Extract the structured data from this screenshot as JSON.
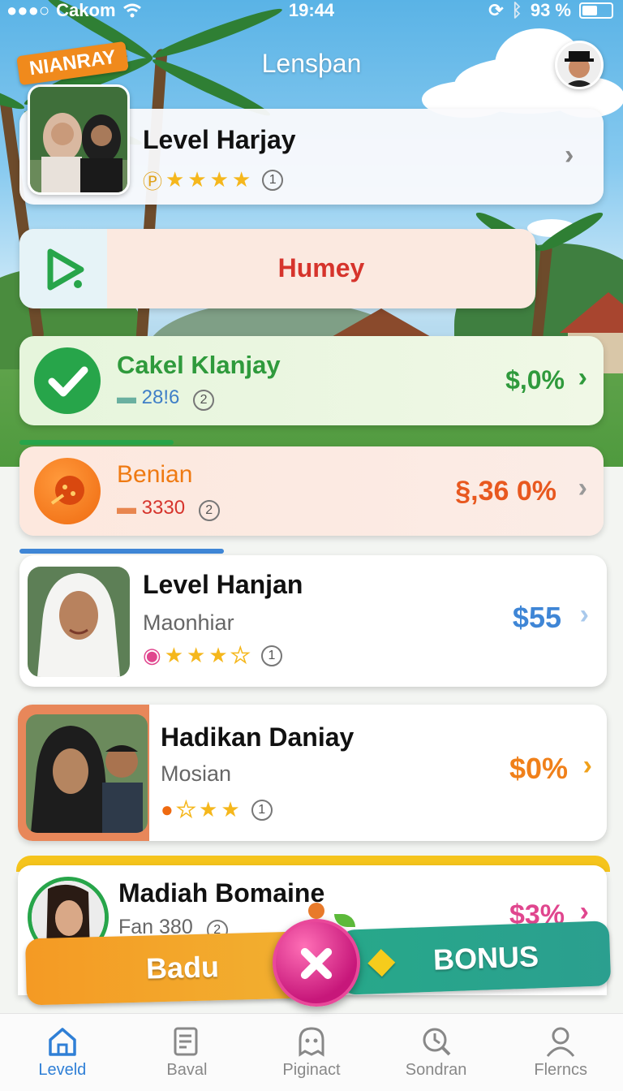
{
  "status_bar": {
    "carrier": "Cakom",
    "time": "19:44",
    "battery": "93 %"
  },
  "header": {
    "title": "Lensþan",
    "badge": "NIANRAY"
  },
  "featured": {
    "title": "Level Harjay",
    "rating_count": "1"
  },
  "banner": {
    "label": "Humey"
  },
  "rows": [
    {
      "title": "Cakel Klanjay",
      "meta": "28!6",
      "meta_count": "2",
      "value": "$,0%",
      "accent": "#2f9a3c"
    },
    {
      "title": "Benian",
      "meta": "3330",
      "meta_count": "2",
      "value": "§,36 0%",
      "accent": "#e8581f"
    },
    {
      "title": "Level Hanjan",
      "subtitle": "Maonhiar",
      "rating_count": "1",
      "value": "$55",
      "accent": "#3f86d6"
    },
    {
      "title": "Hadikan Daniay",
      "subtitle": "Mosian",
      "rating_count": "1",
      "value": "$0%",
      "accent": "#f0801a"
    },
    {
      "title": "Madiah Bomaine",
      "subtitle": "Fan 380",
      "meta_count": "2",
      "value": "$3%",
      "accent": "#e0468e"
    }
  ],
  "actions": {
    "left": "Badu",
    "right": "BONUS"
  },
  "tabs": [
    {
      "label": "Leveld",
      "icon": "home-icon",
      "active": true
    },
    {
      "label": "Baval",
      "icon": "document-icon"
    },
    {
      "label": "Piginact",
      "icon": "ghost-icon"
    },
    {
      "label": "Sondran",
      "icon": "search-icon"
    },
    {
      "label": "Flerncs",
      "icon": "profile-icon"
    }
  ]
}
